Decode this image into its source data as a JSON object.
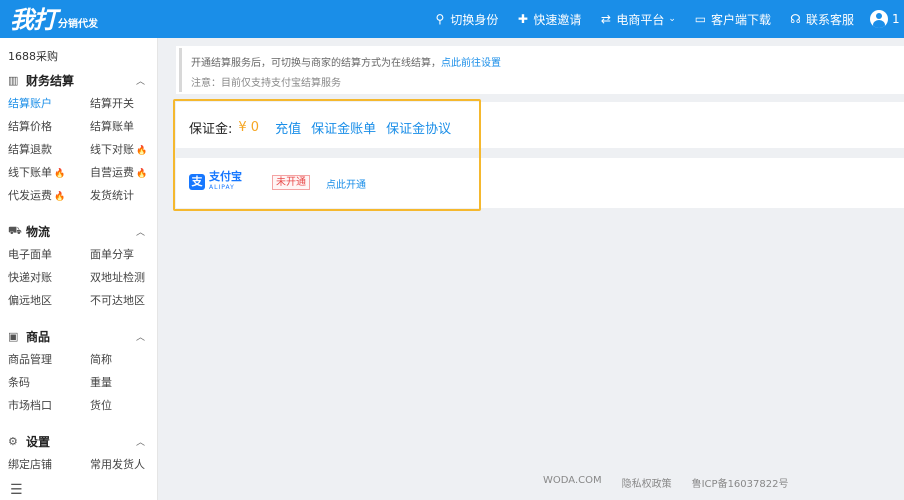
{
  "header": {
    "logo_main": "我打",
    "logo_sub": "分销代发",
    "nav": [
      {
        "icon": "user-switch-icon",
        "glyph": "⚲",
        "label": "切换身份"
      },
      {
        "icon": "add-user-icon",
        "glyph": "✚",
        "label": "快速邀请"
      },
      {
        "icon": "swap-icon",
        "glyph": "⇄",
        "label": "电商平台",
        "dropdown": true
      },
      {
        "icon": "monitor-icon",
        "glyph": "▭",
        "label": "客户端下载"
      },
      {
        "icon": "headset-icon",
        "glyph": "☊",
        "label": "联系客服"
      }
    ],
    "user_number": "1"
  },
  "sidebar": {
    "top_item": "1688采购",
    "sections": [
      {
        "title": "财务结算",
        "icon": "chart-icon",
        "glyph": "▥",
        "items": [
          {
            "label": "结算账户",
            "active": true
          },
          {
            "label": "结算开关"
          },
          {
            "label": "结算价格"
          },
          {
            "label": "结算账单"
          },
          {
            "label": "结算退款"
          },
          {
            "label": "线下对账",
            "hot": true
          },
          {
            "label": "线下账单",
            "hot": true
          },
          {
            "label": "自营运费",
            "hot": true
          },
          {
            "label": "代发运费",
            "hot": true
          },
          {
            "label": "发货统计"
          }
        ]
      },
      {
        "title": "物流",
        "icon": "truck-icon",
        "glyph": "⛟",
        "items": [
          {
            "label": "电子面单"
          },
          {
            "label": "面单分享"
          },
          {
            "label": "快递对账"
          },
          {
            "label": "双地址检测"
          },
          {
            "label": "偏远地区"
          },
          {
            "label": "不可达地区"
          }
        ]
      },
      {
        "title": "商品",
        "icon": "box-icon",
        "glyph": "▣",
        "items": [
          {
            "label": "商品管理"
          },
          {
            "label": "简称"
          },
          {
            "label": "条码"
          },
          {
            "label": "重量"
          },
          {
            "label": "市场档口"
          },
          {
            "label": "货位"
          }
        ]
      },
      {
        "title": "设置",
        "icon": "gear-icon",
        "glyph": "⚙",
        "items": [
          {
            "label": "绑定店铺"
          },
          {
            "label": "常用发货人"
          }
        ]
      }
    ],
    "collapse_icon": "☰"
  },
  "notice": {
    "line1_text": "开通结算服务后，可切换与商家的结算方式为在线结算，",
    "line1_link": "点此前往设置",
    "line2_text": "注意：目前仅支持支付宝结算服务"
  },
  "deposit": {
    "label": "保证金:",
    "amount": "¥ 0",
    "links": [
      "充值",
      "保证金账单",
      "保证金协议"
    ]
  },
  "alipay": {
    "logo_glyph": "支",
    "name_cn": "支付宝",
    "name_en": "ALIPAY",
    "status": "未开通",
    "action": "点此开通"
  },
  "footer": {
    "items": [
      "WODA.COM",
      "隐私权政策",
      "鲁ICP备16037822号"
    ]
  },
  "colors": {
    "header_bg": "#1a8ee8",
    "accent": "#1a8ee8",
    "highlight_border": "#f5b82e",
    "amount": "#f5a623",
    "badge": "#e84b4b",
    "alipay": "#1677ff"
  }
}
